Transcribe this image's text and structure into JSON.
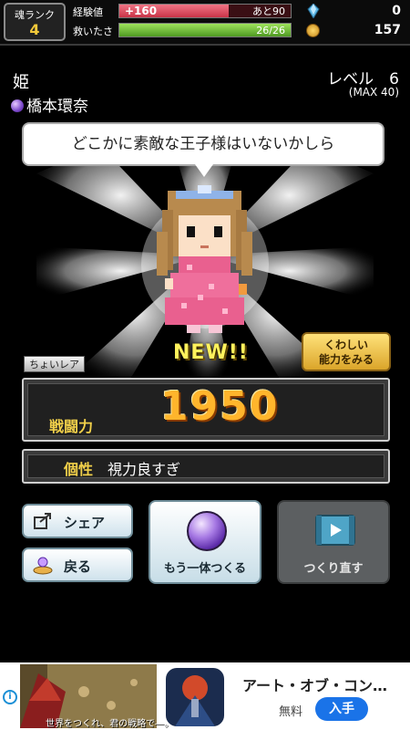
{
  "top_bar": {
    "rank_label": "魂ランク",
    "rank_value": "4",
    "exp_label": "経験値",
    "exp_gain": "+160",
    "exp_remaining": "あと90",
    "exp_progress": 0.64,
    "help_label": "救いたさ",
    "help_value": "26/26",
    "help_progress": 1.0,
    "gems": "0",
    "coins": "157"
  },
  "character": {
    "title": "姫",
    "author": "橋本環奈",
    "level_label": "レベル　6",
    "level_max": "(MAX 40)"
  },
  "speech": "どこかに素敵な王子様はいないかしら",
  "new_label": "NEW!!",
  "rarity": "ちょいレア",
  "detail_button": {
    "line1": "くわしい",
    "line2": "能力をみる"
  },
  "power": {
    "label": "戦闘力",
    "value": "1950"
  },
  "trait": {
    "label": "個性",
    "value": "視力良すぎ"
  },
  "buttons": {
    "share": "シェア",
    "back": "戻る",
    "create_another": "もう一体つくる",
    "redo": "つくり直す"
  },
  "ad": {
    "caption": "世界をつくれ、君の戦略で―。",
    "title": "アート・オブ・コン…",
    "price": "無料",
    "install": "入手",
    "info_icon": "i"
  },
  "colors": {
    "exp": "#d8475a",
    "help": "#7cc44a",
    "accent_gold": "#f1d04a",
    "power": "#ffb52c",
    "install": "#1a73e8"
  },
  "icons": [
    "gem-icon",
    "coin-icon",
    "orb-icon",
    "share-icon",
    "home-icon",
    "film-icon",
    "info-icon"
  ]
}
